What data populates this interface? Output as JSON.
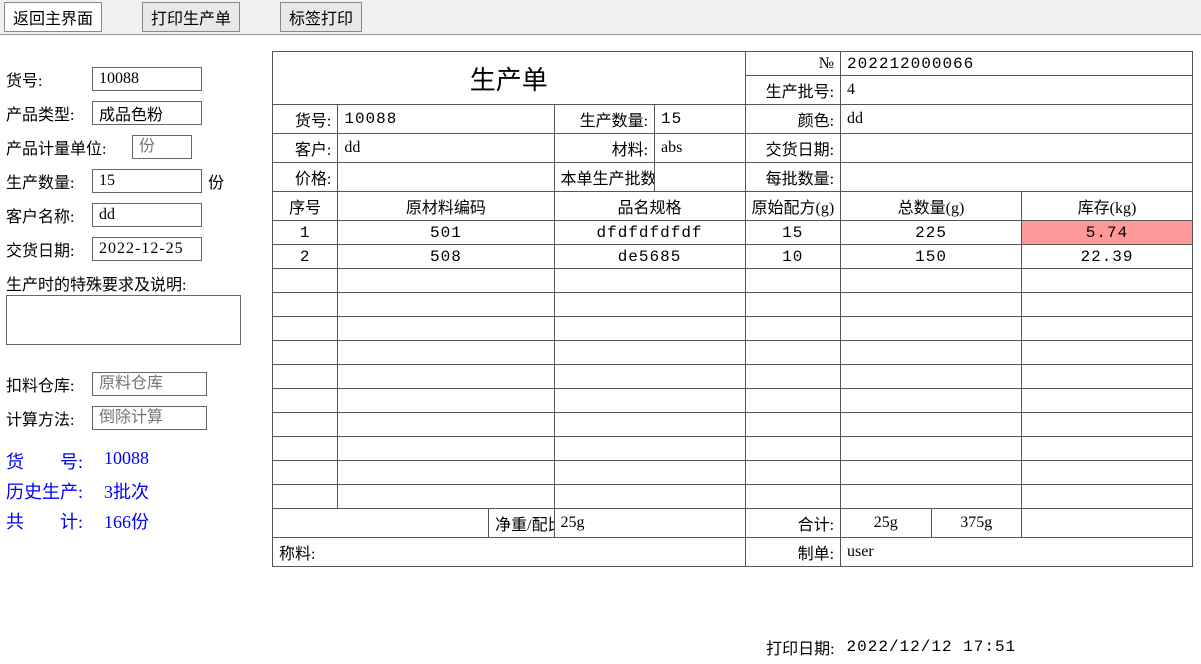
{
  "toolbar": {
    "back": "返回主界面",
    "print_order": "打印生产单",
    "print_label": "标签打印"
  },
  "form": {
    "product_no_label": "货号:",
    "product_no": "10088",
    "product_type_label": "产品类型:",
    "product_type": "成品色粉",
    "unit_label": "产品计量单位:",
    "unit_placeholder": "份",
    "qty_label": "生产数量:",
    "qty": "15",
    "qty_unit": "份",
    "customer_label": "客户名称:",
    "customer": "dd",
    "delivery_label": "交货日期:",
    "delivery": "2022-12-25",
    "notes_label": "生产时的特殊要求及说明:",
    "warehouse_label": "扣料仓库:",
    "warehouse_placeholder": "原料仓库",
    "calc_label": "计算方法:",
    "calc_placeholder": "倒除计算"
  },
  "summary": {
    "product_no_label": "货　　号:",
    "product_no": "10088",
    "history_label": "历史生产:",
    "history": "3批次",
    "total_label": "共　　计:",
    "total": "166份"
  },
  "sheet": {
    "title": "生产单",
    "order_no_label": "№",
    "order_no": "202212000066",
    "batch_label": "生产批号:",
    "batch": "4",
    "product_no_label": "货号:",
    "product_no": "10088",
    "qty_label": "生产数量:",
    "qty": "15",
    "color_label": "颜色:",
    "color": "dd",
    "customer_label": "客户:",
    "customer": "dd",
    "material_label": "材料:",
    "material": "abs",
    "delivery_label": "交货日期:",
    "price_label": "价格:",
    "batch_count_label": "本单生产批数:",
    "per_batch_label": "每批数量:",
    "headers": {
      "seq": "序号",
      "code": "原材料编码",
      "spec": "品名规格",
      "formula": "原始配方(g)",
      "total_qty": "总数量(g)",
      "stock": "库存(kg)"
    },
    "rows": [
      {
        "seq": "1",
        "code": "501",
        "spec": "dfdfdfdfdf",
        "formula": "15",
        "total_qty": "225",
        "stock": "5.74",
        "highlight": true
      },
      {
        "seq": "2",
        "code": "508",
        "spec": "de5685",
        "formula": "10",
        "total_qty": "150",
        "stock": "22.39",
        "highlight": false
      }
    ],
    "footer": {
      "net_label": "净重/配比:",
      "net": "25g",
      "total_label": "合计:",
      "total_formula": "25g",
      "total_qty": "375g",
      "weigh_label": "称料:",
      "maker_label": "制单:",
      "maker": "user",
      "print_date_label": "打印日期:",
      "print_date": "2022/12/12 17:51"
    }
  }
}
